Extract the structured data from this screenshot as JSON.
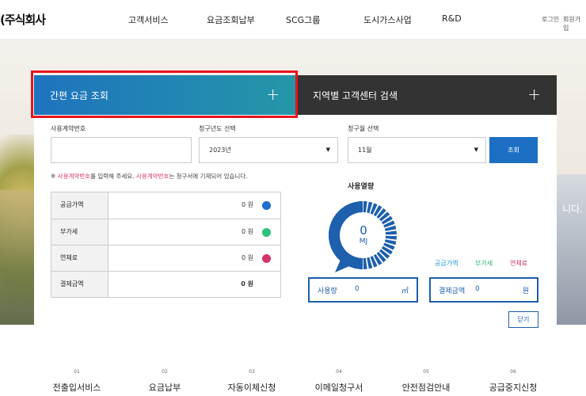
{
  "header": {
    "logo": "(주식회사",
    "nav": [
      "고객서비스",
      "요금조회납부",
      "SCG그룹",
      "도시가스사업",
      "R&D"
    ],
    "login": "로그인",
    "join": "회원가입"
  },
  "hero": {
    "side_text": "니다."
  },
  "tabs": [
    {
      "label": "간편 요금 조회",
      "icon": "plus-icon"
    },
    {
      "label": "지역별 고객센터 검색",
      "icon": "plus-icon"
    }
  ],
  "form": {
    "contract_label": "사용계약번호",
    "contract_value": "",
    "year_label": "청구년도 선택",
    "year_value": "2023년",
    "month_label": "청구월 선택",
    "month_value": "11월",
    "search_button": "조회"
  },
  "notice": {
    "prefix": "※ ",
    "term1": "사용계약번호",
    "mid": "를 입력해 주세요. ",
    "term2": "사용계약번호",
    "suffix": "는 청구서에 기재되어 있습니다."
  },
  "charges": [
    {
      "label": "공급가액",
      "value": "0 원",
      "color": "#1e6fd0"
    },
    {
      "label": "부가세",
      "value": "0 원",
      "color": "#2bc27c"
    },
    {
      "label": "연체료",
      "value": "0 원",
      "color": "#d6336c"
    },
    {
      "label": "결제금액",
      "value": "0 원",
      "color": ""
    }
  ],
  "usage": {
    "title": "사용열량",
    "value": "0",
    "unit": "MJ",
    "gauge_fill_fraction": 0.0
  },
  "legend": [
    {
      "label": "공급가액",
      "color": "#1e9ad6"
    },
    {
      "label": "부가세",
      "color": "#2bb673"
    },
    {
      "label": "연체료",
      "color": "#d6336c"
    }
  ],
  "usage_box": {
    "label": "사용량",
    "value": "0",
    "unit": "㎥"
  },
  "payment_box": {
    "label": "결제금액",
    "value": "0",
    "unit": "원"
  },
  "close_button": "닫기",
  "services": [
    {
      "num": "01",
      "label": "전출입서비스"
    },
    {
      "num": "02",
      "label": "요금납부"
    },
    {
      "num": "03",
      "label": "자동이체신청"
    },
    {
      "num": "04",
      "label": "이메일청구서"
    },
    {
      "num": "05",
      "label": "안전점검안내"
    },
    {
      "num": "06",
      "label": "공급중지신청"
    }
  ]
}
